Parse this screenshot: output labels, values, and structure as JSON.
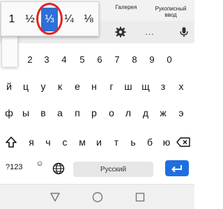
{
  "top_tabs": {
    "gallery": "Галерея",
    "handwriting_line1": "Рукописный",
    "handwriting_line2": "ввод"
  },
  "toolbar": {
    "icons": [
      "gear-icon",
      "more-dots-icon",
      "microphone-icon"
    ],
    "dots": "..."
  },
  "fraction_popup": {
    "items": [
      "1",
      "½",
      "⅓",
      "¼",
      "⅛"
    ],
    "selected": "⅓",
    "accent": "#2f6fd8",
    "highlight_circle": "#e32222"
  },
  "keyboard": {
    "digits": [
      "2",
      "3",
      "4",
      "5",
      "6",
      "7",
      "8",
      "9",
      "0"
    ],
    "row1": [
      "й",
      "ц",
      "у",
      "к",
      "е",
      "н",
      "г",
      "ш",
      "щ",
      "з",
      "х"
    ],
    "row2": [
      "ф",
      "ы",
      "в",
      "а",
      "п",
      "р",
      "о",
      "л",
      "д",
      "ж",
      "э"
    ],
    "row3": [
      "я",
      "ч",
      "с",
      "м",
      "и",
      "т",
      "ь",
      "б",
      "ю"
    ],
    "symbols_label": "?123",
    "emoji": "☺",
    "space_label": "Русский",
    "enter_color": "#1f6fe0"
  },
  "navbar": {
    "icons": [
      "back-icon",
      "home-icon",
      "recents-icon"
    ]
  }
}
